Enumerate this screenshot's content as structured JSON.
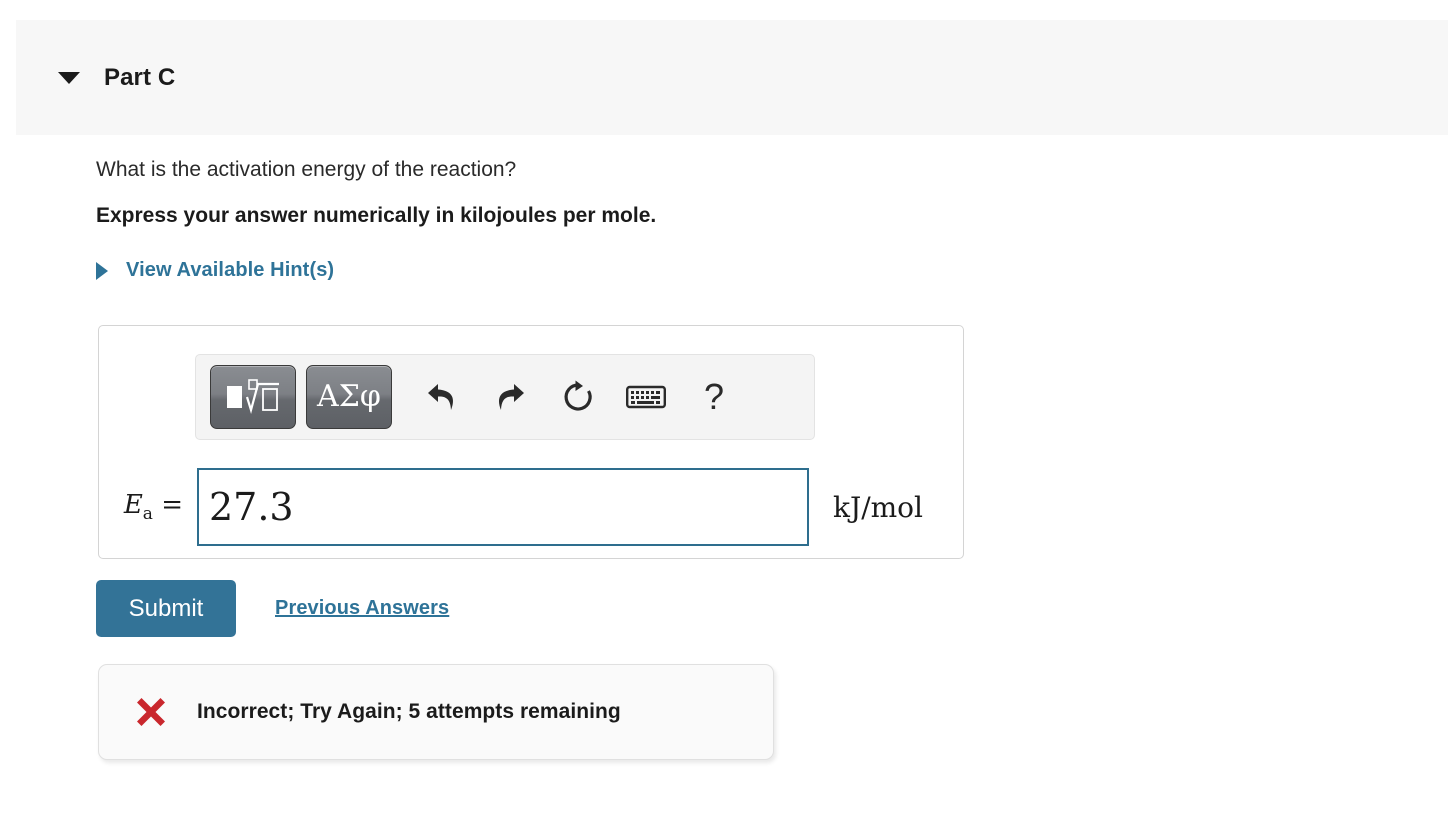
{
  "header": {
    "toggle_icon": "caret-down-icon",
    "title": "Part C"
  },
  "question": {
    "prompt": "What is the activation energy of the reaction?",
    "instruction": "Express your answer numerically in kilojoules per mole."
  },
  "hints": {
    "toggle_icon": "caret-right-icon",
    "label": "View Available Hint(s)"
  },
  "math_toolbar": {
    "buttons": [
      {
        "name": "math-templates-button",
        "icon": "square-root-template-icon",
        "label": ""
      },
      {
        "name": "greek-symbols-button",
        "icon": "greek-letters-icon",
        "label": "ΑΣφ"
      },
      {
        "name": "undo-button",
        "icon": "undo-arrow-icon",
        "label": ""
      },
      {
        "name": "redo-button",
        "icon": "redo-arrow-icon",
        "label": ""
      },
      {
        "name": "reset-button",
        "icon": "reset-circular-arrow-icon",
        "label": ""
      },
      {
        "name": "keyboard-button",
        "icon": "keyboard-icon",
        "label": ""
      },
      {
        "name": "help-button",
        "icon": "question-mark-icon",
        "label": "?"
      }
    ]
  },
  "answer": {
    "label_symbol": "E",
    "label_subscript": "a",
    "label_equals": "=",
    "value": "27.3",
    "placeholder": "",
    "unit": "kJ/mol"
  },
  "actions": {
    "submit_label": "Submit",
    "previous_answers_label": "Previous Answers"
  },
  "feedback": {
    "icon": "red-x-icon",
    "message": "Incorrect; Try Again; 5 attempts remaining"
  },
  "colors": {
    "accent_blue": "#337397",
    "link_blue": "#2e7398",
    "input_border": "#2e6e8e",
    "error_red": "#c9272d",
    "header_band": "#f7f7f7",
    "panel_border": "#d4d4d4"
  }
}
